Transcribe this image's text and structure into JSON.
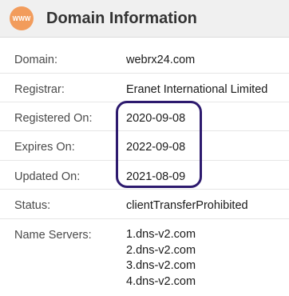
{
  "header": {
    "icon_text": "WWW",
    "title": "Domain Information"
  },
  "rows": [
    {
      "label": "Domain:",
      "value": "webrx24.com"
    },
    {
      "label": "Registrar:",
      "value": "Eranet International Limited"
    },
    {
      "label": "Registered On:",
      "value": "2020-09-08"
    },
    {
      "label": "Expires On:",
      "value": "2022-09-08"
    },
    {
      "label": "Updated On:",
      "value": "2021-08-09"
    },
    {
      "label": "Status:",
      "value": "clientTransferProhibited"
    }
  ],
  "name_servers": {
    "label": "Name Servers:",
    "values": [
      "1.dns-v2.com",
      "2.dns-v2.com",
      "3.dns-v2.com",
      "4.dns-v2.com"
    ]
  },
  "colors": {
    "icon_bg": "#f29c5c",
    "highlight_border": "#2d1a6e",
    "header_bg": "#f0f0f0"
  }
}
